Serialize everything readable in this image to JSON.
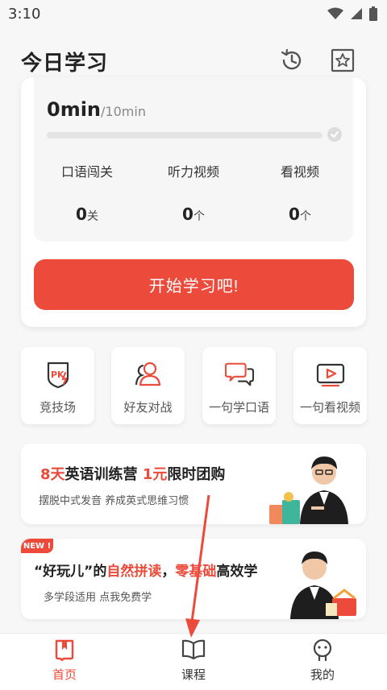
{
  "status": {
    "time": "3:10"
  },
  "header": {
    "title": "今日学习",
    "history_icon": "history-icon",
    "favorite_icon": "star-bookmark-icon"
  },
  "progress": {
    "current": "0min",
    "goal": "/10min",
    "fraction": 0.0,
    "stats": [
      {
        "label": "口语闯关",
        "value": "0",
        "unit": "关"
      },
      {
        "label": "听力视频",
        "value": "0",
        "unit": "个"
      },
      {
        "label": "看视频",
        "value": "0",
        "unit": "个"
      }
    ],
    "start_button": "开始学习吧!"
  },
  "features": [
    {
      "label": "竞技场",
      "icon": "pk-shield-icon"
    },
    {
      "label": "好友对战",
      "icon": "friends-icon"
    },
    {
      "label": "一句学口语",
      "icon": "chat-bubbles-icon"
    },
    {
      "label": "一句看视频",
      "icon": "video-icon"
    }
  ],
  "banner1": {
    "title_highlight_1": "8天",
    "title_text_1": "英语训练营 ",
    "title_highlight_2": "1元",
    "title_text_2": "限时团购",
    "subtitle": "摆脱中式发音 养成英式思维习惯"
  },
  "banner2": {
    "badge": "NEW !",
    "title_text_1": "“好玩儿”的",
    "title_highlight_1": "自然拼读",
    "title_text_2": "，",
    "title_highlight_2": "零基础",
    "title_text_3": "高效学",
    "subtitle": "多学段适用 点我免费学"
  },
  "tabbar": {
    "items": [
      {
        "label": "首页",
        "icon": "home-book-icon",
        "active": true
      },
      {
        "label": "课程",
        "icon": "open-book-icon",
        "active": false
      },
      {
        "label": "我的",
        "icon": "profile-icon",
        "active": false
      }
    ]
  },
  "colors": {
    "accent": "#ec4a3a",
    "background": "#f7f7f7"
  }
}
